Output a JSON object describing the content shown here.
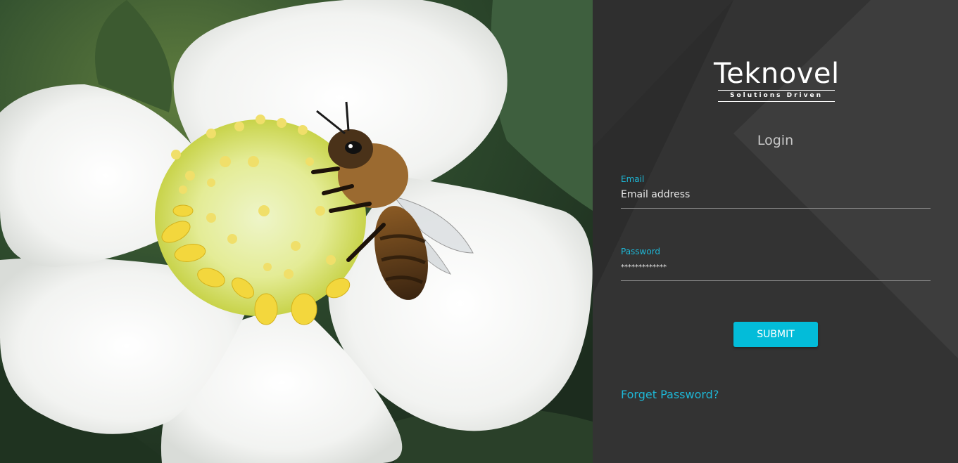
{
  "brand": {
    "name": "Teknovel",
    "tagline": "Solutions  Driven"
  },
  "login": {
    "title": "Login",
    "email_label": "Email",
    "email_value": "Email address",
    "password_label": "Password",
    "password_value": "*************",
    "submit_label": "SUBMIT",
    "forget_label": "Forget Password?"
  },
  "colors": {
    "accent": "#1eb6d5",
    "button": "#03bcd9",
    "panel": "#2c2c2c"
  },
  "icons": {
    "logo_mark": "owl-glasses-icon"
  }
}
